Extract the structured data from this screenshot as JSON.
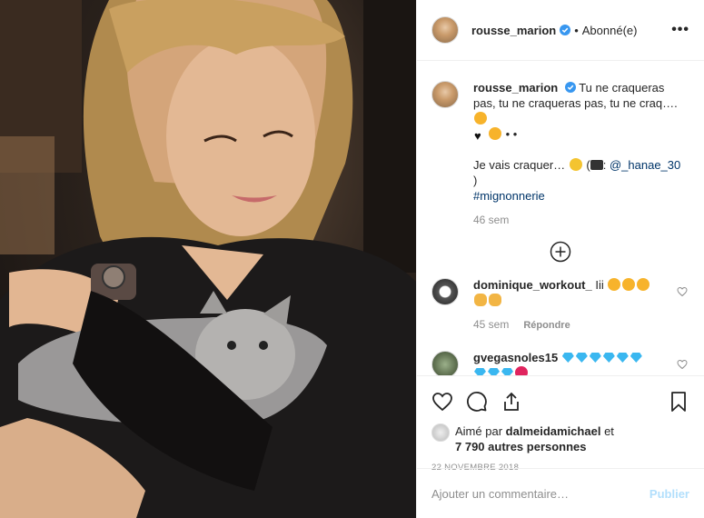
{
  "header": {
    "username": "rousse_marion",
    "separator": "•",
    "follow_status": "Abonné(e)",
    "more": "•••"
  },
  "caption": {
    "username": "rousse_marion",
    "line1": "Tu ne craqueras pas, tu ne craqueras pas, tu ne craq….",
    "line2_tail": "• •",
    "line3_start": "Je vais craquer…",
    "line3_credit_open": "(",
    "line3_credit_handle": "@_hanae_30",
    "line3_close": ")",
    "hashtag": "#mignonnerie",
    "time": "46 sem"
  },
  "comments": [
    {
      "username": "dominique_workout_",
      "text": "Iii",
      "time": "45 sem",
      "reply": "Répondre"
    },
    {
      "username": "gvegasnoles15",
      "text": ""
    }
  ],
  "likes": {
    "prefix": "Aimé par",
    "user": "dalmeidamichael",
    "and": "et",
    "others": "7 790 autres personnes"
  },
  "date": "22 NOVEMBRE 2018",
  "add_comment": {
    "placeholder": "Ajouter un commentaire…",
    "post": "Publier"
  },
  "colors": {
    "verified": "#3897f0",
    "link": "#003569",
    "muted": "#8e8e8e",
    "publish_disabled": "#b2dffc"
  }
}
